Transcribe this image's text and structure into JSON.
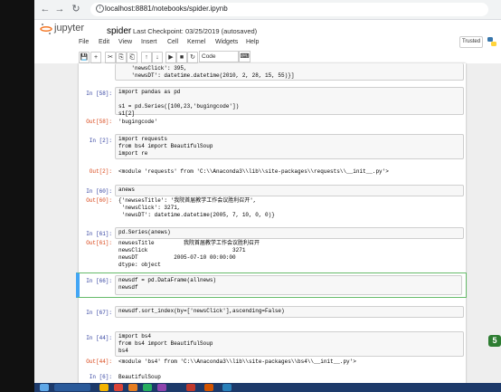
{
  "browser": {
    "url": "localhost:8881/notebooks/spider.ipynb"
  },
  "jupyter": {
    "logo_text": "jupyter",
    "notebook_name": "spider",
    "checkpoint": "Last Checkpoint: 03/25/2019 (autosaved)",
    "menu": [
      "File",
      "Edit",
      "View",
      "Insert",
      "Cell",
      "Kernel",
      "Widgets",
      "Help"
    ],
    "trusted": "Trusted",
    "cell_type": "Code"
  },
  "toolbar": [
    "💾",
    "+",
    "✂",
    "⎘",
    "⎗",
    "↑",
    "↓",
    "▶",
    "■",
    "↻",
    "⏭"
  ],
  "cells": [
    {
      "id": "c0",
      "prompt": "",
      "code": "    'newsClick': 395,\n    'newsDT': datetime.datetime(2010, 2, 28, 15, 55)}]"
    },
    {
      "id": "c1",
      "prompt": "In [58]:",
      "code": "import pandas as pd\n\ns1 = pd.Series([100,23,'bugingcode'])\ns1[2]"
    },
    {
      "id": "o1",
      "prompt": "Out[58]:",
      "out": "'bugingcode'"
    },
    {
      "id": "c2",
      "prompt": "In [2]:",
      "code": "import requests\nfrom bs4 import BeautifulSoup\nimport re"
    },
    {
      "id": "o2",
      "prompt": "Out[2]:",
      "out": "<module 'requests' from 'C:\\\\Anaconda3\\\\lib\\\\site-packages\\\\requests\\\\__init__.py'>"
    },
    {
      "id": "c3",
      "prompt": "In [60]:",
      "code": "anews"
    },
    {
      "id": "o3",
      "prompt": "Out[60]:",
      "out": "{'newsesTitle': '我院首届教学工作会议胜利召开',\n 'newsClick': 3271,\n 'newsDT': datetime.datetime(2005, 7, 10, 0, 0)}"
    },
    {
      "id": "c4",
      "prompt": "In [61]:",
      "code": "pd.Series(anews)"
    },
    {
      "id": "o4",
      "prompt": "Out[61]:",
      "out": "newsesTitle         我院首届教学工作会议胜利召开\nnewsClick                          3271\nnewsDT           2005-07-10 00:00:00\ndtype: object"
    },
    {
      "id": "c5",
      "prompt": "In [66]:",
      "code": "newsdf = pd.DataFrame(allnews)\nnewsdf"
    },
    {
      "id": "c6",
      "prompt": "In [67]:",
      "code": "newsdf.sort_index(by=['newsClick'],ascending=False)"
    },
    {
      "id": "c7",
      "prompt": "In [44]:",
      "code": "import bs4\nfrom bs4 import BeautifulSoup\nbs4"
    },
    {
      "id": "o7",
      "prompt": "Out[44]:",
      "out": "<module 'bs4' from 'C:\\\\Anaconda3\\\\lib\\\\site-packages\\\\bs4\\\\__init__.py'>"
    },
    {
      "id": "c8",
      "prompt": "In [6]:",
      "code": "BeautifulSoup"
    }
  ],
  "badge": "5",
  "colors": {
    "accent": "#42a5f5",
    "selected_border": "#66bb6a",
    "prompt_in": "#303f9f",
    "prompt_out": "#d84315"
  }
}
